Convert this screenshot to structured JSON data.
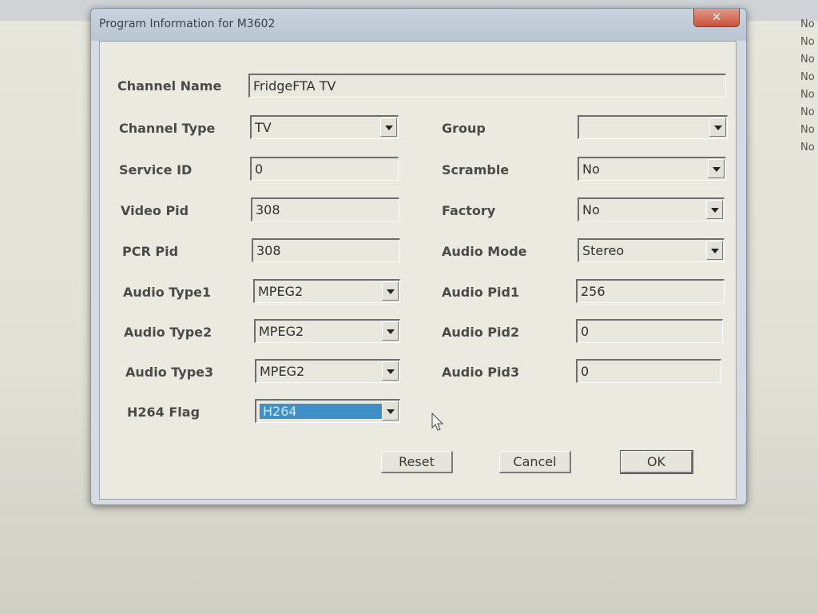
{
  "background": {
    "right_column": [
      "No",
      "No",
      "No",
      "No",
      "No",
      "No",
      "No",
      "No"
    ]
  },
  "dialog": {
    "title": "Program Information for M3602",
    "close_glyph": "✕",
    "fields": {
      "channel_name": {
        "label": "Channel Name",
        "value": "FridgeFTA TV"
      },
      "channel_type": {
        "label": "Channel Type",
        "value": "TV"
      },
      "service_id": {
        "label": "Service ID",
        "value": "0"
      },
      "video_pid": {
        "label": "Video Pid",
        "value": "308"
      },
      "pcr_pid": {
        "label": "PCR Pid",
        "value": "308"
      },
      "audio_type1": {
        "label": "Audio Type1",
        "value": "MPEG2"
      },
      "audio_type2": {
        "label": "Audio Type2",
        "value": "MPEG2"
      },
      "audio_type3": {
        "label": "Audio Type3",
        "value": "MPEG2"
      },
      "h264_flag": {
        "label": "H264 Flag",
        "value": "H264"
      },
      "group": {
        "label": "Group",
        "value": ""
      },
      "scramble": {
        "label": "Scramble",
        "value": "No"
      },
      "factory": {
        "label": "Factory",
        "value": "No"
      },
      "audio_mode": {
        "label": "Audio Mode",
        "value": "Stereo"
      },
      "audio_pid1": {
        "label": "Audio Pid1",
        "value": "256"
      },
      "audio_pid2": {
        "label": "Audio Pid2",
        "value": "0"
      },
      "audio_pid3": {
        "label": "Audio Pid3",
        "value": "0"
      }
    },
    "buttons": {
      "reset": "Reset",
      "cancel": "Cancel",
      "ok": "OK"
    }
  },
  "colors": {
    "selection": "#3f8fc9",
    "close_button": "#c9513a"
  }
}
